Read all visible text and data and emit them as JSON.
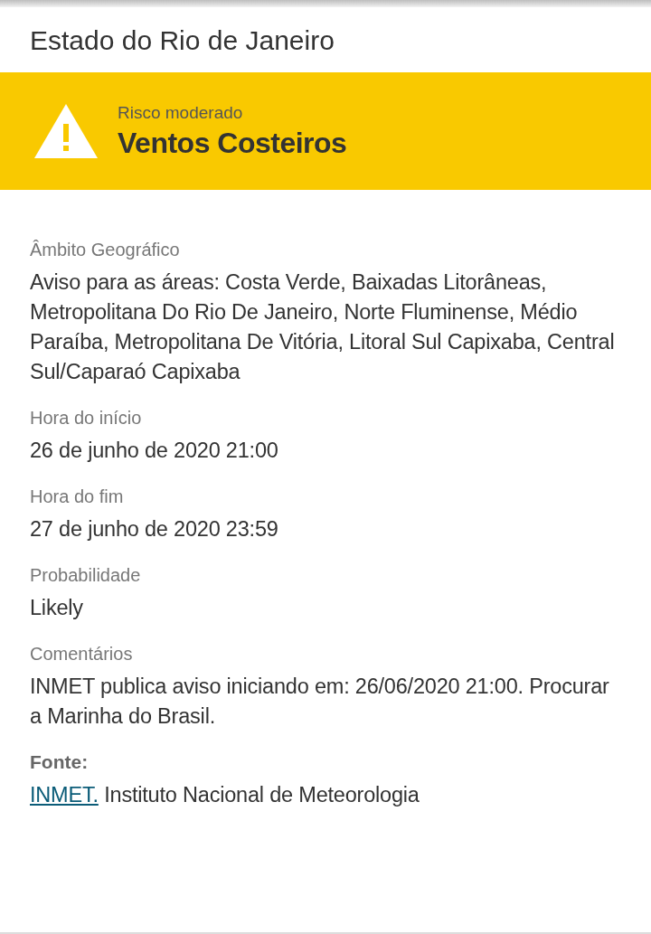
{
  "header": {
    "title": "Estado do Rio de Janeiro"
  },
  "alert": {
    "risk_label": "Risco moderado",
    "event": "Ventos Costeiros"
  },
  "details": [
    {
      "label": "Âmbito Geográfico",
      "value": "Aviso para as áreas: Costa Verde, Baixadas Litorâneas, Metropolitana Do Rio De Janeiro, Norte Fluminense, Médio Paraíba, Metropolitana De Vitória, Litoral Sul Capixaba, Central Sul/Caparaó Capixaba"
    },
    {
      "label": "Hora do início",
      "value": "26 de junho de 2020 21:00"
    },
    {
      "label": "Hora do fim",
      "value": "27 de junho de 2020 23:59"
    },
    {
      "label": "Probabilidade",
      "value": "Likely"
    },
    {
      "label": "Comentários",
      "value": "INMET publica aviso iniciando em: 26/06/2020 21:00. Procurar a Marinha do Brasil."
    }
  ],
  "source": {
    "label": "Fonte:",
    "link": "INMET.",
    "text": "Instituto Nacional de Meteorologia"
  }
}
